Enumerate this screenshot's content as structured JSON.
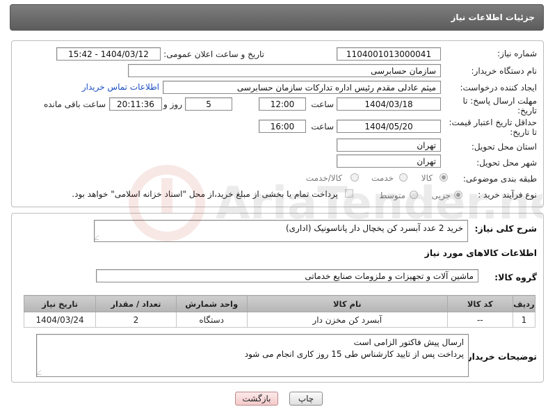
{
  "header": {
    "title": "جزئیات اطلاعات نیاز"
  },
  "form": {
    "need_number": {
      "label": "شماره نیاز:",
      "value": "1104001013000041"
    },
    "announce_datetime": {
      "label": "تاریخ و ساعت اعلان عمومی:",
      "value": "1404/03/12 - 15:42"
    },
    "buyer_org": {
      "label": "نام دستگاه خریدار:",
      "value": "سازمان حسابرسی"
    },
    "requester": {
      "label": "ایجاد کننده درخواست:",
      "value": "میثم عادلی مقدم رئیس اداره تدارکات سازمان حسابرسی",
      "contact_link": "اطلاعات تماس خریدار"
    },
    "reply_deadline": {
      "label_line1": "مهلت ارسال پاسخ: تا",
      "label_line2": "تاریخ:",
      "date": "1404/03/18",
      "time_label": "ساعت",
      "time": "12:00",
      "days": "5",
      "days_label": "روز و",
      "remaining": "20:11:36",
      "remaining_label": "ساعت باقی مانده"
    },
    "price_validity": {
      "label_line1": "حداقل تاریخ اعتبار قیمت:",
      "label_line2": "تا تاریخ:",
      "date": "1404/05/20",
      "time_label": "ساعت",
      "time": "16:00"
    },
    "province": {
      "label": "استان محل تحویل:",
      "value": "تهران"
    },
    "city": {
      "label": "شهر محل تحویل:",
      "value": "تهران"
    },
    "category": {
      "label": "طبقه بندی موضوعی:",
      "options": [
        "کالا",
        "خدمت",
        "کالا/خدمت"
      ],
      "selected": "کالا"
    },
    "process_type": {
      "label": "نوع فرآیند خرید :",
      "options": [
        "جزیی",
        "متوسط"
      ],
      "selected": "جزیی",
      "note": "پرداخت تمام یا بخشی از مبلغ خرید،از محل \"اسناد خزانه اسلامی\" خواهد بود."
    }
  },
  "summary": {
    "label": "شرح کلی نیاز:",
    "value": "خرید 2 عدد آبسرد کن یخچال دار پاناسونیک (اداری)"
  },
  "goods_info": {
    "title": "اطلاعات کالاهای مورد نیاز"
  },
  "goods_group": {
    "label": "گروه کالا:",
    "value": "ماشین آلات و تجهیزات و ملزومات صنایع خدماتی"
  },
  "table": {
    "headers": [
      "ردیف",
      "کد کالا",
      "نام کالا",
      "واحد شمارش",
      "تعداد / مقدار",
      "تاریخ نیاز"
    ],
    "rows": [
      [
        "1",
        "--",
        "آبسرد کن مخزن دار",
        "دستگاه",
        "2",
        "1404/03/24"
      ]
    ]
  },
  "buyer_notes": {
    "label": "توضیحات خریدار:",
    "line1": "ارسال پیش فاکتور الزامی است",
    "line2": "پرداخت پس از تایید کارشناس طی 15 روز کاری انجام می شود"
  },
  "buttons": {
    "print": "چاپ",
    "back": "بازگشت"
  },
  "watermark": {
    "text": "AriaTender.neT"
  },
  "colors": {
    "header_bg": "#6b6b6b",
    "link": "#1a4fc4",
    "back_button": "#f4caca",
    "watermark": "#c0392b"
  }
}
